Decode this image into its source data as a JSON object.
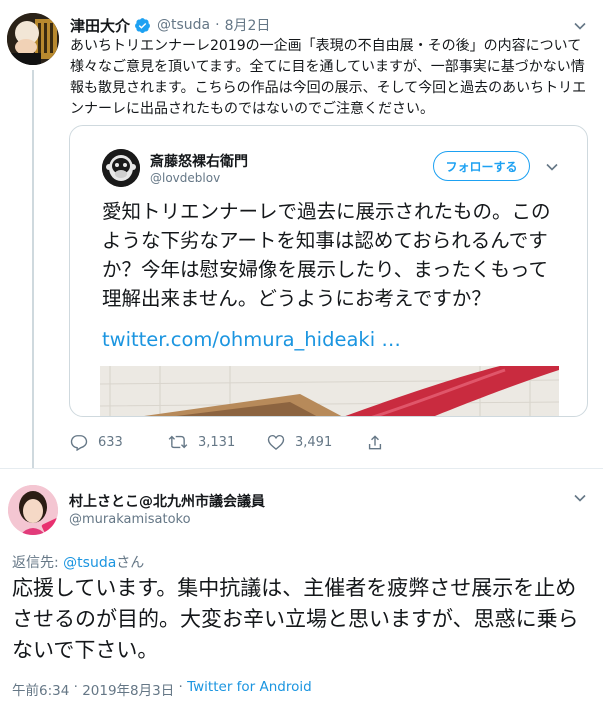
{
  "tweet": {
    "author_name": "津田大介",
    "author_handle": "@tsuda",
    "separator": "·",
    "date": "8月2日",
    "text": "あいちトリエンナーレ2019の一企画「表現の不自由展・その後」の内容について様々なご意見を頂いてます。全てに目を通していますが、一部事実に基づかない情報も散見されます。こちらの作品は今回の展示、そして今回と過去のあいちトリエンナーレに出品されたものではないのでご注意ください。",
    "quoted": {
      "author_name": "斎藤怒裸右衛門",
      "author_handle": "@lovdeblov",
      "follow_label": "フォローする",
      "text": "愛知トリエンナーレで過去に展示されたもの。このような下劣なアートを知事は認めておられるんですか？今年は慰安婦像を展示したり、まったくもって理解出来ません。どうようにお考えですか？",
      "link": "twitter.com/ohmura_hideaki …"
    },
    "actions": {
      "replies": "633",
      "retweets": "3,131",
      "likes": "3,491"
    }
  },
  "reply": {
    "author_name": "村上さとこ@北九州市議会議員",
    "author_handle": "@murakamisatoko",
    "reply_to_prefix": "返信先: ",
    "reply_to_mention": "@tsuda",
    "reply_to_suffix": "さん",
    "text": "応援しています。集中抗議は、主催者を疲弊させ展示を止めさせるのが目的。大変お辛い立場と思いますが、思惑に乗らないで下さい。",
    "time": "午前6:34",
    "meta_separator": " · ",
    "date": "2019年8月3日",
    "via": "Twitter for Android"
  },
  "colors": {
    "accent": "#1da1f2",
    "link": "#1b95e0",
    "secondary_text": "#657786",
    "border": "#cfd9de"
  }
}
